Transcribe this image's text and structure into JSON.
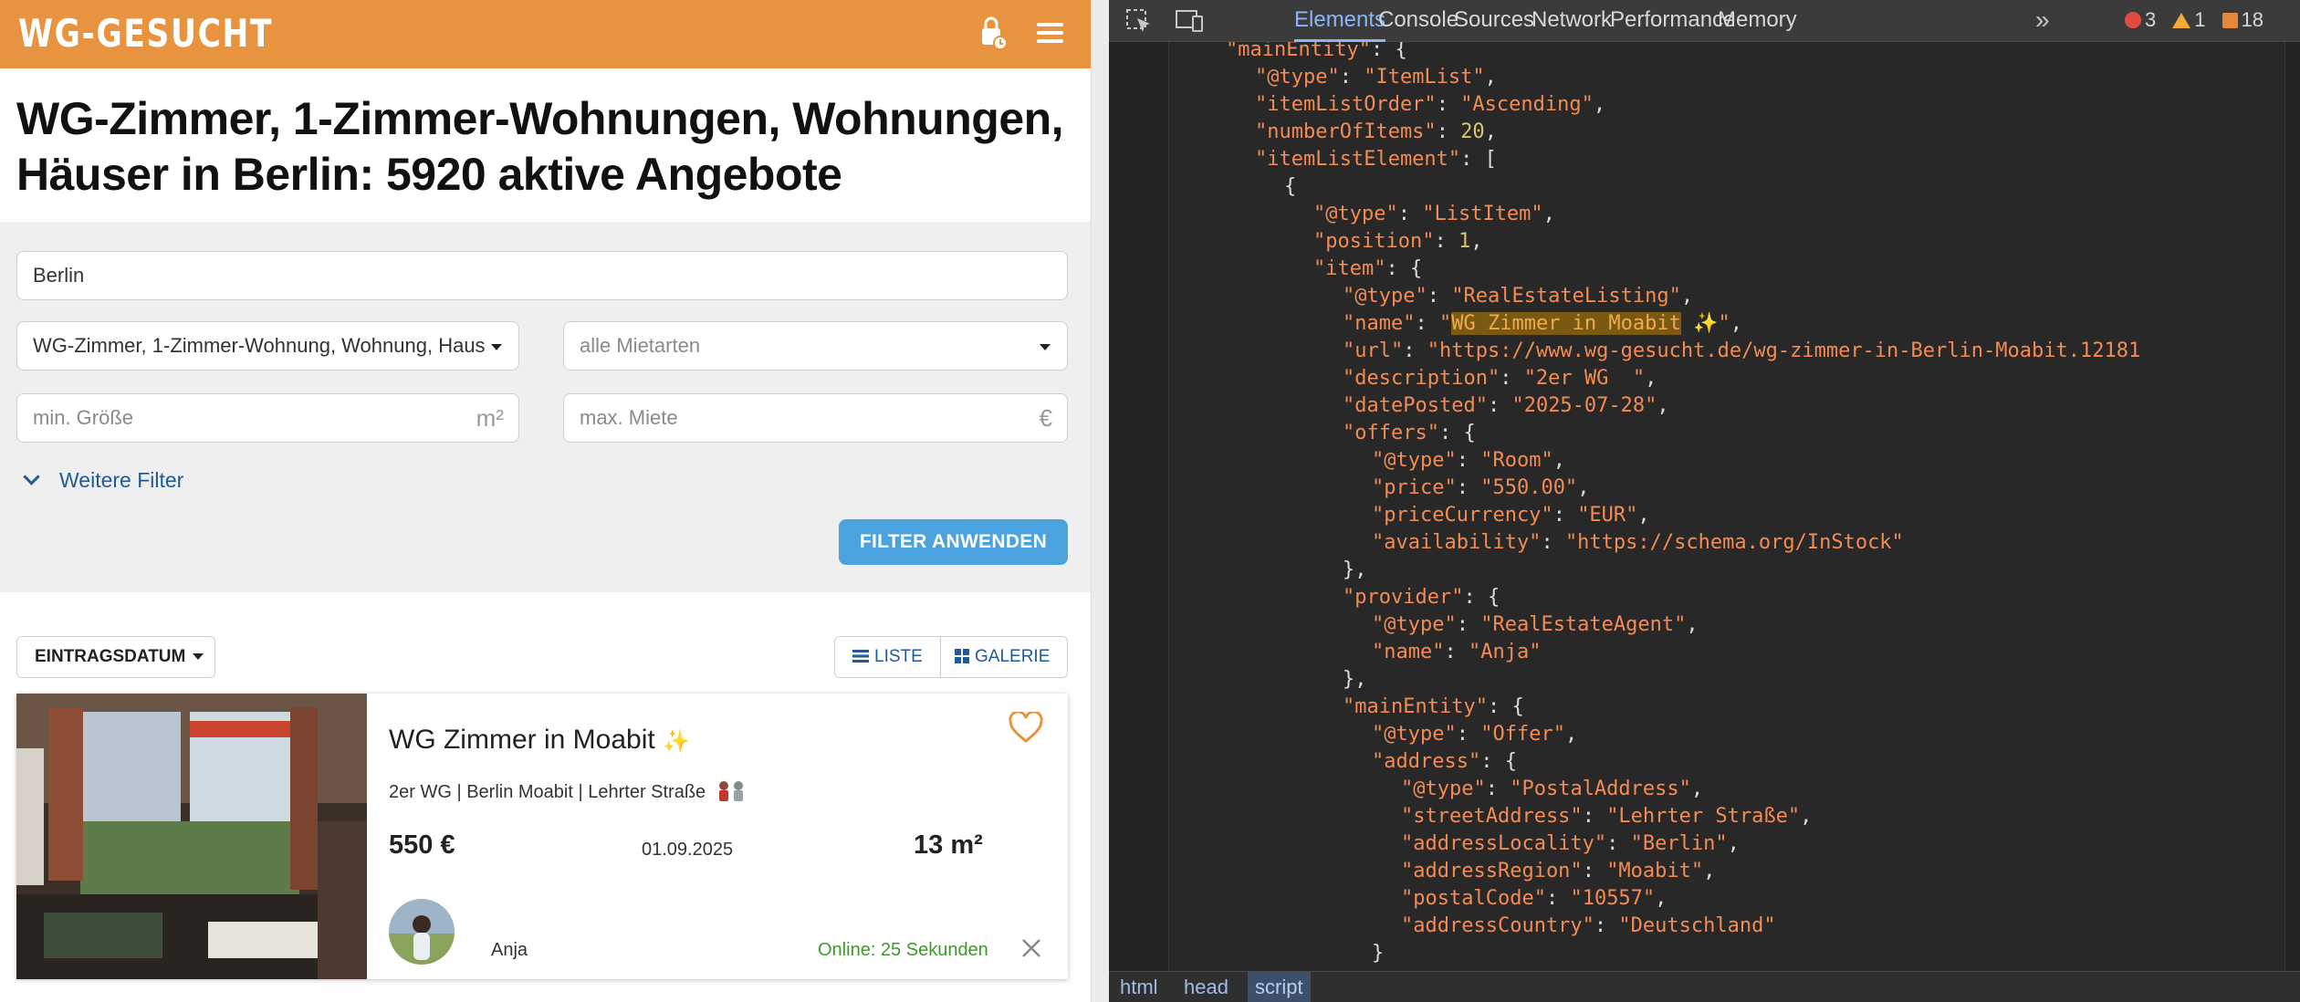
{
  "site": {
    "logo": "WG-GESUCHT",
    "page_title_line1": "WG-Zimmer, 1-Zimmer-Wohnungen, Wohnungen,",
    "page_title_line2": "Häuser in Berlin: 5920 aktive Angebote",
    "filters": {
      "city_value": "Berlin",
      "category_value": "WG-Zimmer, 1-Zimmer-Wohnung, Wohnung, Haus",
      "rent_type_placeholder": "alle Mietarten",
      "min_size_placeholder": "min. Größe",
      "size_unit": "m²",
      "max_rent_placeholder": "max. Miete",
      "currency_unit": "€",
      "more_filters": "Weitere Filter",
      "apply_button": "FILTER ANWENDEN"
    },
    "sort_label": "EINTRAGSDATUM",
    "view_list": "LISTE",
    "view_gallery": "GALERIE",
    "listing": {
      "title": "WG Zimmer in Moabit",
      "title_emoji": "✨",
      "subtitle": "2er WG | Berlin Moabit | Lehrter Straße",
      "price": "550 €",
      "date": "01.09.2025",
      "size": "13 m²",
      "provider": "Anja",
      "online": "Online: 25 Sekunden"
    },
    "colors": {
      "brand": "#e8933f",
      "button": "#4aa3df",
      "link": "#1f5b96",
      "online": "#3c9a2a"
    }
  },
  "devtools": {
    "tabs": [
      "Elements",
      "Console",
      "Sources",
      "Network",
      "Performance",
      "Memory"
    ],
    "active_tab": "Elements",
    "more_tabs_icon": "chevron-double-right-icon",
    "error_count": "3",
    "warning_count": "1",
    "issue_count": "18",
    "breadcrumb": [
      "html",
      "head",
      "script"
    ],
    "active_breadcrumb": "script",
    "code_lines": [
      [
        {
          "t": "\"mainEntity\"",
          "c": "k"
        },
        {
          "t": ": {",
          "c": "p"
        }
      ],
      [
        {
          "t": "\"@type\"",
          "c": "k"
        },
        {
          "t": ": ",
          "c": "p"
        },
        {
          "t": "\"ItemList\"",
          "c": "s"
        },
        {
          "t": ",",
          "c": "p"
        }
      ],
      [
        {
          "t": "\"itemListOrder\"",
          "c": "k"
        },
        {
          "t": ": ",
          "c": "p"
        },
        {
          "t": "\"Ascending\"",
          "c": "s"
        },
        {
          "t": ",",
          "c": "p"
        }
      ],
      [
        {
          "t": "\"numberOfItems\"",
          "c": "k"
        },
        {
          "t": ": ",
          "c": "p"
        },
        {
          "t": "20",
          "c": "n"
        },
        {
          "t": ",",
          "c": "p"
        }
      ],
      [
        {
          "t": "\"itemListElement\"",
          "c": "k"
        },
        {
          "t": ": [",
          "c": "p"
        }
      ],
      [
        {
          "t": "{",
          "c": "p"
        }
      ],
      [
        {
          "t": "\"@type\"",
          "c": "k"
        },
        {
          "t": ": ",
          "c": "p"
        },
        {
          "t": "\"ListItem\"",
          "c": "s"
        },
        {
          "t": ",",
          "c": "p"
        }
      ],
      [
        {
          "t": "\"position\"",
          "c": "k"
        },
        {
          "t": ": ",
          "c": "p"
        },
        {
          "t": "1",
          "c": "n"
        },
        {
          "t": ",",
          "c": "p"
        }
      ],
      [
        {
          "t": "\"item\"",
          "c": "k"
        },
        {
          "t": ": {",
          "c": "p"
        }
      ],
      [
        {
          "t": "\"@type\"",
          "c": "k"
        },
        {
          "t": ": ",
          "c": "p"
        },
        {
          "t": "\"RealEstateListing\"",
          "c": "s"
        },
        {
          "t": ",",
          "c": "p"
        }
      ],
      [
        {
          "t": "\"name\"",
          "c": "k"
        },
        {
          "t": ": ",
          "c": "p"
        },
        {
          "t": "\"",
          "c": "s"
        },
        {
          "t": "WG Zimmer in Moabit",
          "c": "hl"
        },
        {
          "t": " ✨\"",
          "c": "s"
        },
        {
          "t": ",",
          "c": "p"
        }
      ],
      [
        {
          "t": "\"url\"",
          "c": "k"
        },
        {
          "t": ": ",
          "c": "p"
        },
        {
          "t": "\"https://www.wg-gesucht.de/wg-zimmer-in-Berlin-Moabit.12181",
          "c": "s"
        }
      ],
      [
        {
          "t": "\"description\"",
          "c": "k"
        },
        {
          "t": ": ",
          "c": "p"
        },
        {
          "t": "\"2er WG  \"",
          "c": "s"
        },
        {
          "t": ",",
          "c": "p"
        }
      ],
      [
        {
          "t": "\"datePosted\"",
          "c": "k"
        },
        {
          "t": ": ",
          "c": "p"
        },
        {
          "t": "\"2025-07-28\"",
          "c": "s"
        },
        {
          "t": ",",
          "c": "p"
        }
      ],
      [
        {
          "t": "\"offers\"",
          "c": "k"
        },
        {
          "t": ": {",
          "c": "p"
        }
      ],
      [
        {
          "t": "\"@type\"",
          "c": "k"
        },
        {
          "t": ": ",
          "c": "p"
        },
        {
          "t": "\"Room\"",
          "c": "s"
        },
        {
          "t": ",",
          "c": "p"
        }
      ],
      [
        {
          "t": "\"price\"",
          "c": "k"
        },
        {
          "t": ": ",
          "c": "p"
        },
        {
          "t": "\"550.00\"",
          "c": "s"
        },
        {
          "t": ",",
          "c": "p"
        }
      ],
      [
        {
          "t": "\"priceCurrency\"",
          "c": "k"
        },
        {
          "t": ": ",
          "c": "p"
        },
        {
          "t": "\"EUR\"",
          "c": "s"
        },
        {
          "t": ",",
          "c": "p"
        }
      ],
      [
        {
          "t": "\"availability\"",
          "c": "k"
        },
        {
          "t": ": ",
          "c": "p"
        },
        {
          "t": "\"https://schema.org/InStock\"",
          "c": "s"
        }
      ],
      [
        {
          "t": "},",
          "c": "p"
        }
      ],
      [
        {
          "t": "\"provider\"",
          "c": "k"
        },
        {
          "t": ": {",
          "c": "p"
        }
      ],
      [
        {
          "t": "\"@type\"",
          "c": "k"
        },
        {
          "t": ": ",
          "c": "p"
        },
        {
          "t": "\"RealEstateAgent\"",
          "c": "s"
        },
        {
          "t": ",",
          "c": "p"
        }
      ],
      [
        {
          "t": "\"name\"",
          "c": "k"
        },
        {
          "t": ": ",
          "c": "p"
        },
        {
          "t": "\"Anja\"",
          "c": "s"
        }
      ],
      [
        {
          "t": "},",
          "c": "p"
        }
      ],
      [
        {
          "t": "\"mainEntity\"",
          "c": "k"
        },
        {
          "t": ": {",
          "c": "p"
        }
      ],
      [
        {
          "t": "\"@type\"",
          "c": "k"
        },
        {
          "t": ": ",
          "c": "p"
        },
        {
          "t": "\"Offer\"",
          "c": "s"
        },
        {
          "t": ",",
          "c": "p"
        }
      ],
      [
        {
          "t": "\"address\"",
          "c": "k"
        },
        {
          "t": ": {",
          "c": "p"
        }
      ],
      [
        {
          "t": "\"@type\"",
          "c": "k"
        },
        {
          "t": ": ",
          "c": "p"
        },
        {
          "t": "\"PostalAddress\"",
          "c": "s"
        },
        {
          "t": ",",
          "c": "p"
        }
      ],
      [
        {
          "t": "\"streetAddress\"",
          "c": "k"
        },
        {
          "t": ": ",
          "c": "p"
        },
        {
          "t": "\"Lehrter Straße\"",
          "c": "s"
        },
        {
          "t": ",",
          "c": "p"
        }
      ],
      [
        {
          "t": "\"addressLocality\"",
          "c": "k"
        },
        {
          "t": ": ",
          "c": "p"
        },
        {
          "t": "\"Berlin\"",
          "c": "s"
        },
        {
          "t": ",",
          "c": "p"
        }
      ],
      [
        {
          "t": "\"addressRegion\"",
          "c": "k"
        },
        {
          "t": ": ",
          "c": "p"
        },
        {
          "t": "\"Moabit\"",
          "c": "s"
        },
        {
          "t": ",",
          "c": "p"
        }
      ],
      [
        {
          "t": "\"postalCode\"",
          "c": "k"
        },
        {
          "t": ": ",
          "c": "p"
        },
        {
          "t": "\"10557\"",
          "c": "s"
        },
        {
          "t": ",",
          "c": "p"
        }
      ],
      [
        {
          "t": "\"addressCountry\"",
          "c": "k"
        },
        {
          "t": ": ",
          "c": "p"
        },
        {
          "t": "\"Deutschland\"",
          "c": "s"
        }
      ],
      [
        {
          "t": "}",
          "c": "p"
        }
      ]
    ]
  }
}
